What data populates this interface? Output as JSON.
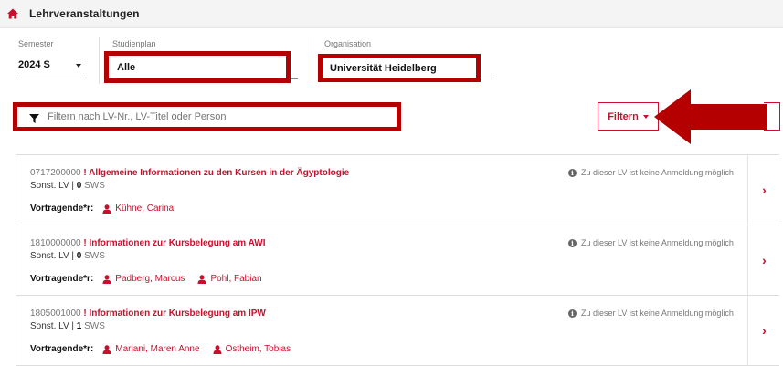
{
  "header": {
    "title": "Lehrveranstaltungen",
    "icon": "home-icon"
  },
  "filters": {
    "semester": {
      "label": "Semester",
      "value": "2024 S"
    },
    "studienplan": {
      "label": "Studienplan",
      "value": "Alle"
    },
    "organisation": {
      "label": "Organisation",
      "value": "Universität Heidelberg"
    },
    "search": {
      "placeholder": "Filtern nach LV-Nr., LV-Titel oder Person"
    },
    "filter_button": "Filtern"
  },
  "colors": {
    "accent": "#c8102e",
    "highlight": "#b40000"
  },
  "courses": [
    {
      "nr": "0717200000",
      "title": "! Allgemeine Informationen zu den Kursen in der Ägyptologie",
      "type": "Sonst. LV |",
      "sws_value": "0",
      "sws_unit": "SWS",
      "status": "Zu dieser LV ist keine Anmeldung möglich",
      "lecturer_label": "Vortragende*r:",
      "lecturers": [
        "Kühne, Carina"
      ]
    },
    {
      "nr": "1810000000",
      "title": "! Informationen zur Kursbelegung am AWI",
      "type": "Sonst. LV |",
      "sws_value": "0",
      "sws_unit": "SWS",
      "status": "Zu dieser LV ist keine Anmeldung möglich",
      "lecturer_label": "Vortragende*r:",
      "lecturers": [
        "Padberg, Marcus",
        "Pohl, Fabian"
      ]
    },
    {
      "nr": "1805001000",
      "title": "! Informationen zur Kursbelegung am IPW",
      "type": "Sonst. LV |",
      "sws_value": "1",
      "sws_unit": "SWS",
      "status": "Zu dieser LV ist keine Anmeldung möglich",
      "lecturer_label": "Vortragende*r:",
      "lecturers": [
        "Mariani, Maren Anne",
        "Ostheim, Tobias"
      ]
    }
  ]
}
